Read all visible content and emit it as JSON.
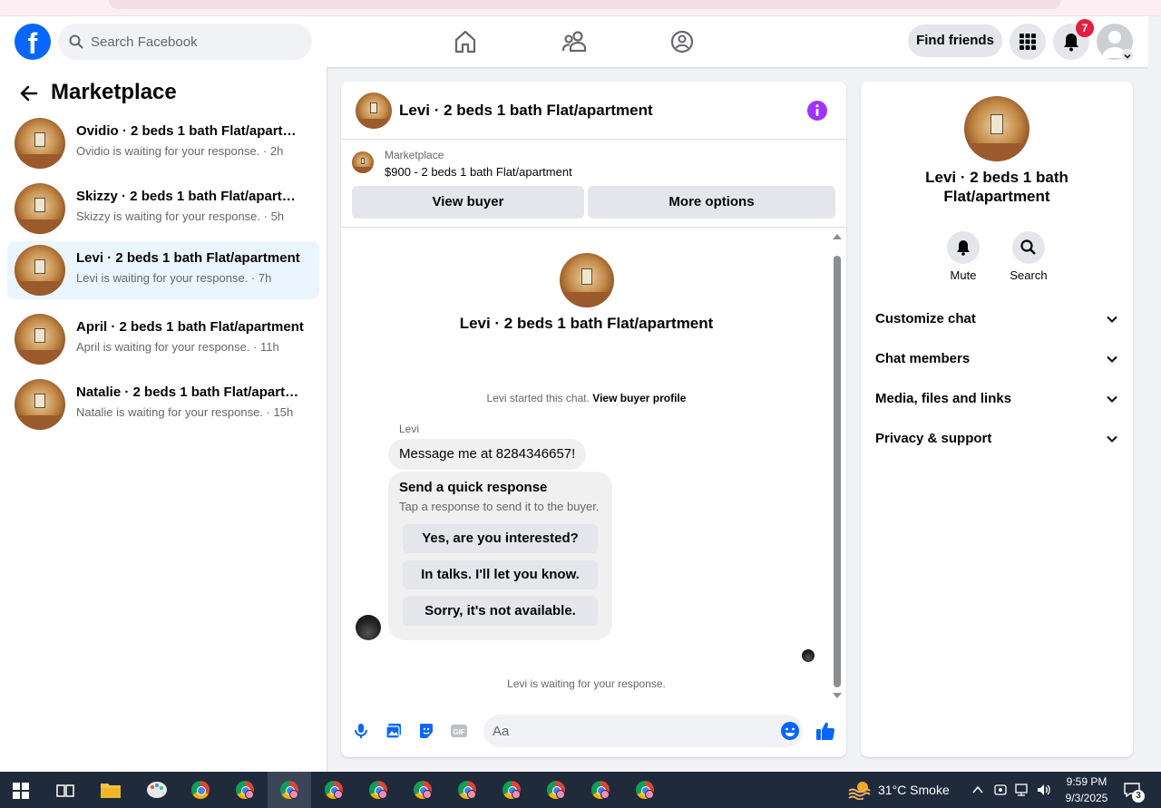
{
  "topnav": {
    "search_placeholder": "Search Facebook",
    "find_friends_label": "Find friends",
    "notification_count": "7"
  },
  "sidebar": {
    "title": "Marketplace",
    "conversations": [
      {
        "title": "Ovidio · 2 beds 1 bath Flat/apartm...",
        "subtitle": "Ovidio is waiting for your response. · 2h"
      },
      {
        "title": "Skizzy · 2 beds 1 bath Flat/apartme...",
        "subtitle": "Skizzy is waiting for your response. · 5h"
      },
      {
        "title": "Levi · 2 beds 1 bath Flat/apartment",
        "subtitle": "Levi is waiting for your response. · 7h",
        "active": true
      },
      {
        "title": "April · 2 beds 1 bath Flat/apartment",
        "subtitle": "April is waiting for your response. · 11h"
      },
      {
        "title": "Natalie · 2 beds 1 bath Flat/apartm...",
        "subtitle": "Natalie is waiting for your response. · 15h"
      }
    ]
  },
  "chat": {
    "header_title": "Levi · 2 beds 1 bath Flat/apartment",
    "listing_source": "Marketplace",
    "listing_price_title": "$900 - 2 beds 1 bath Flat/apartment",
    "view_buyer_label": "View buyer",
    "more_options_label": "More options",
    "center_title": "Levi · 2 beds 1 bath Flat/apartment",
    "started_text": "Levi started this chat.",
    "view_buyer_profile_label": "View buyer profile",
    "sender_name": "Levi",
    "message_text": "Message me at 8284346657!",
    "quick_title": "Send a quick response",
    "quick_subtitle": "Tap a response to send it to the buyer.",
    "quick_responses": [
      "Yes, are you interested?",
      "In talks. I'll let you know.",
      "Sorry, it's not available."
    ],
    "waiting_text": "Levi is waiting for your response.",
    "input_placeholder": "Aa"
  },
  "rpanel": {
    "title": "Levi · 2 beds 1 bath Flat/apartment",
    "mute_label": "Mute",
    "search_label": "Search",
    "sections": [
      "Customize chat",
      "Chat members",
      "Media, files and links",
      "Privacy & support"
    ]
  },
  "taskbar": {
    "weather_text": "31°C  Smoke",
    "time": "9:59 PM",
    "date": "9/3/2025",
    "notification_count": "3"
  },
  "colors": {
    "brand_blue": "#0866ff",
    "messenger_purple": "#a033ff",
    "badge_red": "#e41e3f",
    "active_row": "#ebf5ff"
  }
}
